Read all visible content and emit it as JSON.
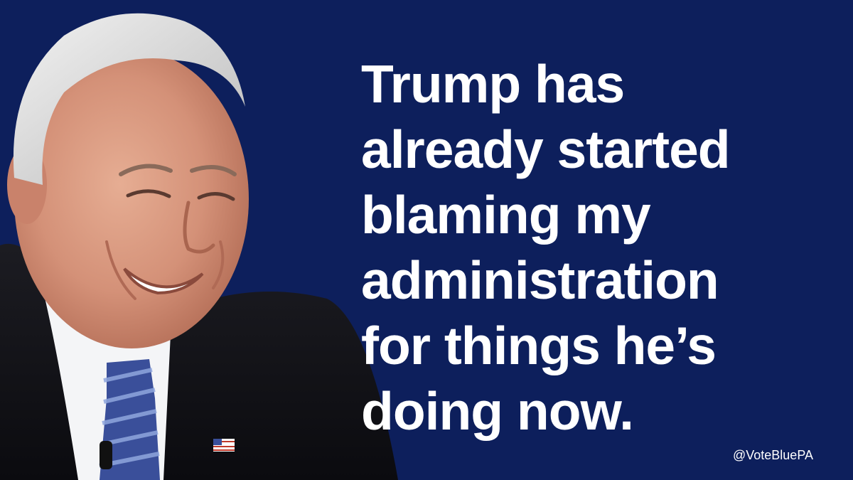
{
  "quote": {
    "lines": [
      "Trump has",
      "already started",
      "blaming my",
      "administration",
      "for things he’s",
      "doing now."
    ]
  },
  "handle": "@VoteBluePA",
  "colors": {
    "background": "#0d1f5c",
    "text": "#ffffff"
  }
}
